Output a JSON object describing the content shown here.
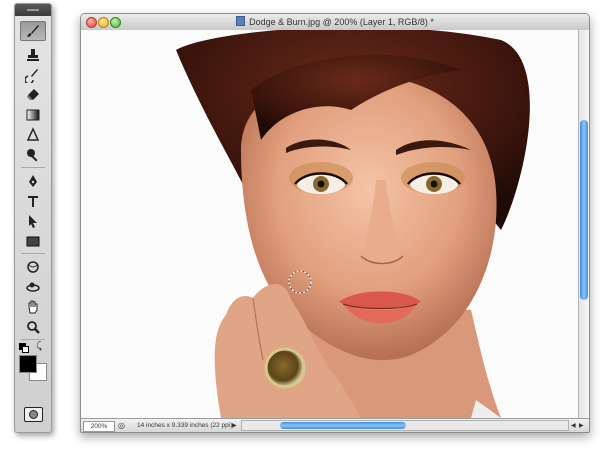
{
  "document": {
    "title": "Dodge & Burn.jpg @ 200% (Layer 1, RGB/8) *",
    "zoom": "200%",
    "info": "14 inches x 9.339 inches (22 ppi)"
  },
  "toolbox": {
    "tools": [
      {
        "name": "brush",
        "active": true
      },
      {
        "name": "clone-stamp"
      },
      {
        "name": "history-brush"
      },
      {
        "name": "eraser"
      },
      {
        "name": "gradient"
      },
      {
        "name": "blur"
      },
      {
        "name": "dodge"
      },
      {
        "name": "pen"
      },
      {
        "name": "type"
      },
      {
        "name": "path-selection"
      },
      {
        "name": "rectangle"
      },
      {
        "name": "3d-rotate"
      },
      {
        "name": "3d-orbit"
      },
      {
        "name": "hand"
      },
      {
        "name": "zoom"
      }
    ],
    "foreground_color": "#000000",
    "background_color": "#ffffff"
  },
  "colors": {
    "scroll_accent": "#3f8fe0",
    "close_light": "#ec5f55",
    "minimize_light": "#f3bc3d",
    "zoom_light": "#5fc24d"
  }
}
